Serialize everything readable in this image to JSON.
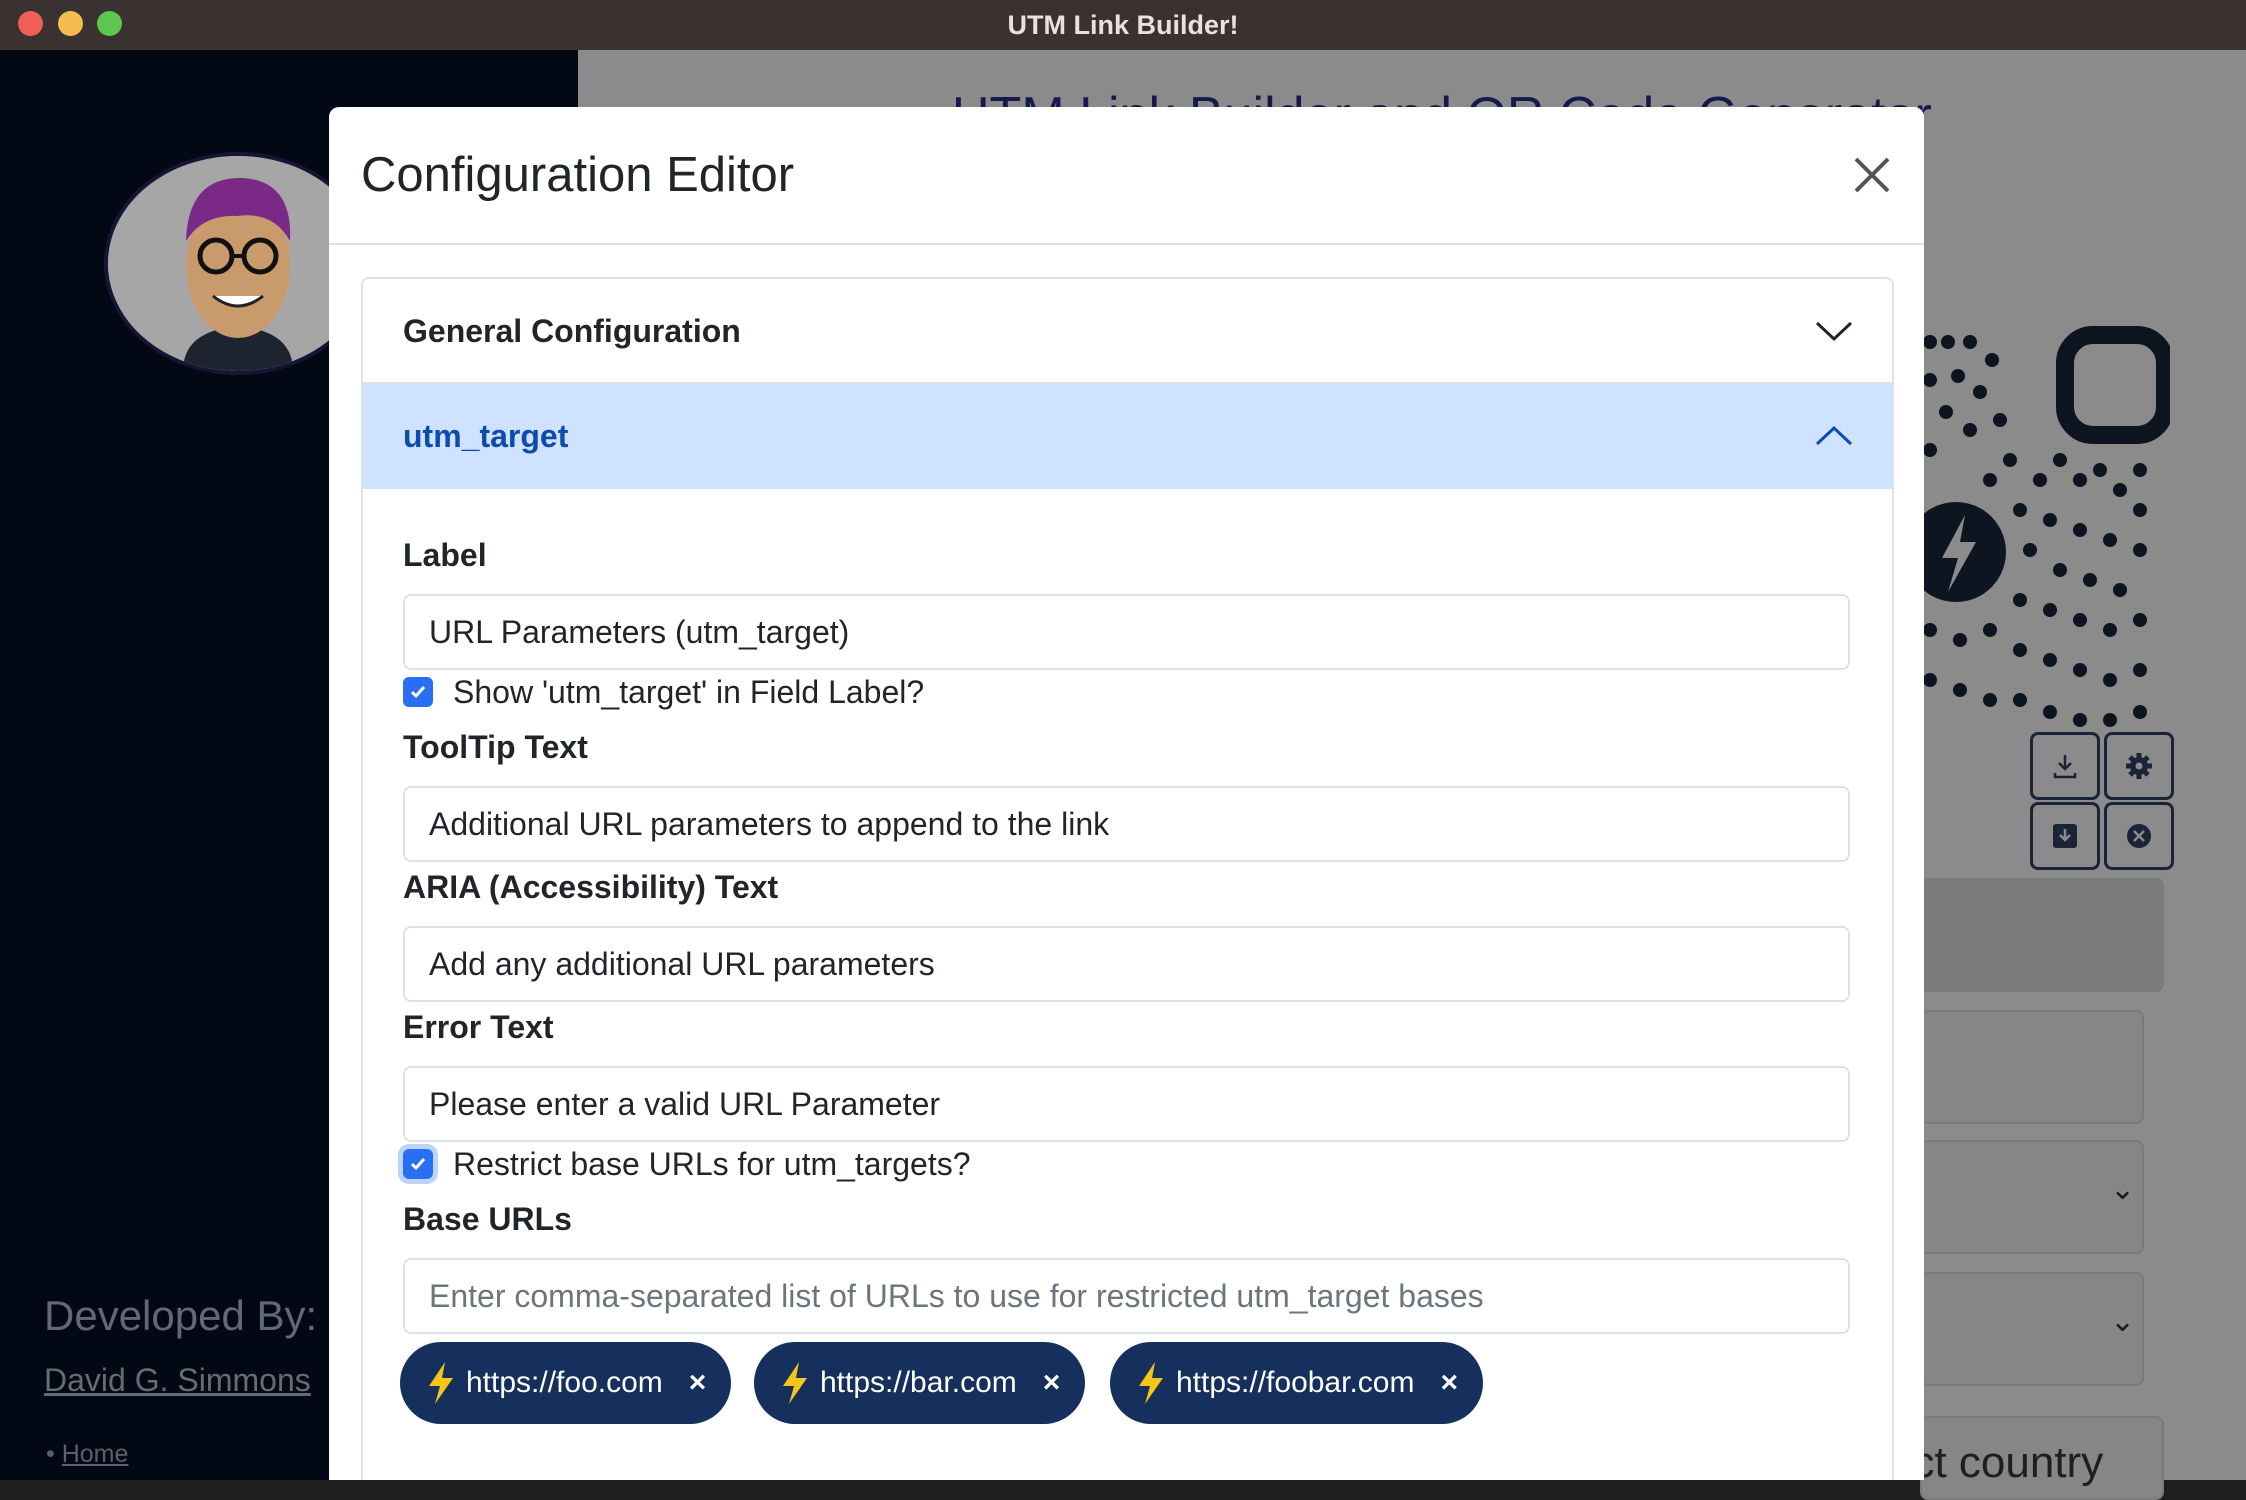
{
  "window": {
    "title": "UTM Link Builder!"
  },
  "background": {
    "heading": "UTM Link Builder and QR Code Generator",
    "developed_by": "Developed By:",
    "developer_name": "David G. Simmons",
    "home_link": "Home",
    "country_select_text": "ect country"
  },
  "modal": {
    "title": "Configuration Editor",
    "sections": [
      {
        "label": "General Configuration",
        "expanded": false
      },
      {
        "label": "utm_target",
        "expanded": true
      }
    ],
    "fields": {
      "label_label": "Label",
      "label_value": "URL Parameters (utm_target)",
      "show_checkbox_label": "Show 'utm_target' in Field Label?",
      "show_checkbox_checked": true,
      "tooltip_label": "ToolTip Text",
      "tooltip_value": "Additional URL parameters to append to the link",
      "aria_label": "ARIA (Accessibility) Text",
      "aria_value": "Add any additional URL parameters",
      "error_label": "Error Text",
      "error_value": "Please enter a valid URL Parameter",
      "restrict_checkbox_label": "Restrict base URLs for utm_targets?",
      "restrict_checkbox_checked": true,
      "base_urls_label": "Base URLs",
      "base_urls_placeholder": "Enter comma-separated list of URLs to use for restricted utm_target bases"
    },
    "base_url_pills": [
      {
        "label": "https://foo.com",
        "remove": "×"
      },
      {
        "label": "https://bar.com",
        "remove": "×"
      },
      {
        "label": "https://foobar.com",
        "remove": "×"
      }
    ]
  },
  "colors": {
    "accent_blue": "#2a6ff3",
    "pill_bg": "#15305c",
    "bolt_yellow": "#f5c518",
    "section_active_bg": "#cfe2ff",
    "section_active_text": "#0c4bb0"
  }
}
